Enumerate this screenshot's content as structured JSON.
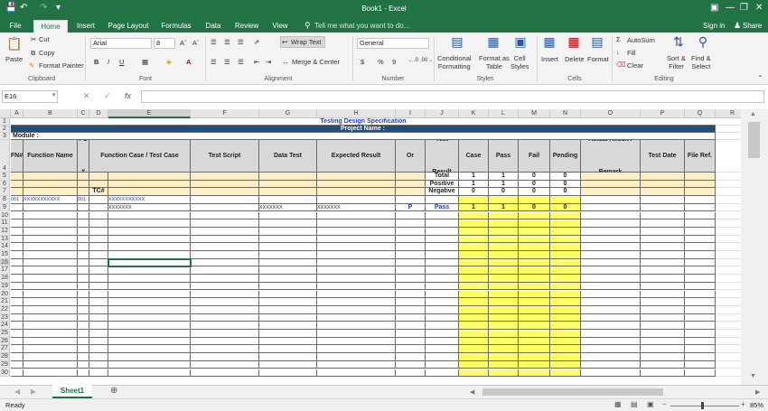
{
  "app": {
    "window_title": "Book1 - Excel",
    "menu_tabs": [
      "File",
      "Home",
      "Insert",
      "Page Layout",
      "Formulas",
      "Data",
      "Review",
      "View"
    ],
    "tell_me": "Tell me what you want to do...",
    "sign_in": "Sign in",
    "share": "Share",
    "accent_color": "#217346"
  },
  "ribbon": {
    "clipboard": {
      "paste": "Paste",
      "cut": "Cut",
      "copy": "Copy",
      "format_painter": "Format Painter",
      "label": "Clipboard"
    },
    "font": {
      "family": "Arial",
      "size": "8",
      "bold": "B",
      "italic": "I",
      "underline": "U",
      "label": "Font"
    },
    "alignment": {
      "wrap_text": "Wrap Text",
      "merge_center": "Merge & Center",
      "label": "Alignment"
    },
    "number": {
      "format": "General",
      "currency": "$",
      "percent": "%",
      "comma": "9",
      "label": "Number"
    },
    "styles": {
      "conditional": "Conditional\nFormatting",
      "format_table": "Format as\nTable",
      "cell_styles": "Cell\nStyles",
      "label": "Styles"
    },
    "cells": {
      "insert": "Insert",
      "delete": "Delete",
      "format": "Format",
      "label": "Cells"
    },
    "editing": {
      "autosum": "AutoSum",
      "fill": "Fill",
      "clear": "Clear",
      "sort_filter": "Sort &\nFilter",
      "find_select": "Find &\nSelect",
      "label": "Editing"
    }
  },
  "formula_bar": {
    "name_box": "E16",
    "fx": "fx",
    "value": ""
  },
  "columns": [
    "A",
    "B",
    "C",
    "D",
    "E",
    "F",
    "G",
    "H",
    "I",
    "J",
    "K",
    "L",
    "M",
    "N",
    "O",
    "P",
    "Q",
    "R"
  ],
  "rows": [
    "1",
    "2",
    "3",
    "4",
    "5",
    "6",
    "7",
    "8",
    "9",
    "10",
    "11",
    "12",
    "13",
    "14",
    "15",
    "16",
    "17",
    "18",
    "19",
    "20",
    "21",
    "22",
    "23",
    "24",
    "25",
    "26",
    "27",
    "28",
    "29",
    "30"
  ],
  "sheet": {
    "title": "Testing Design Specification",
    "project_name": "Project Name :",
    "module": "Module :",
    "headers": {
      "fn": "FN#",
      "function_name": "Function Name",
      "fc": "FC #",
      "function_case": "Function Case /  Test Case",
      "test_script": "Test Script",
      "data_test": "Data Test",
      "expected_result": "Expected Result",
      "positive_negative": "Positive Or Negative",
      "test_result": "Test Result",
      "case": "Case",
      "pass": "Pass",
      "fail": "Fail",
      "pending": "Pending",
      "actual_result": "Actual Result / Remark",
      "test_date": "Test Date",
      "file_ref": "File Ref."
    },
    "summary": [
      {
        "label": "Total",
        "case": "1",
        "pass": "1",
        "fail": "0",
        "pending": "0"
      },
      {
        "label": "Positive",
        "case": "1",
        "pass": "1",
        "fail": "0",
        "pending": "0"
      },
      {
        "label": "Negative",
        "case": "0",
        "pass": "0",
        "fail": "0",
        "pending": "0"
      }
    ],
    "tc_label": "TC#",
    "row8": {
      "fn": "001",
      "function_name": "XXXXXXXXXXX",
      "fc": "001",
      "function_case": "XXXXXXXXXXX"
    },
    "row9": {
      "function_case": "XXXXXXX",
      "data_test": "XXXXXXX",
      "expected_result": "XXXXXXX",
      "positive_negative": "P",
      "test_result": "Pass",
      "case": "1",
      "pass": "1",
      "fail": "0",
      "pending": "0"
    }
  },
  "sheet_tabs": [
    "Sheet1"
  ],
  "status": {
    "ready": "Ready",
    "zoom": "85%"
  }
}
